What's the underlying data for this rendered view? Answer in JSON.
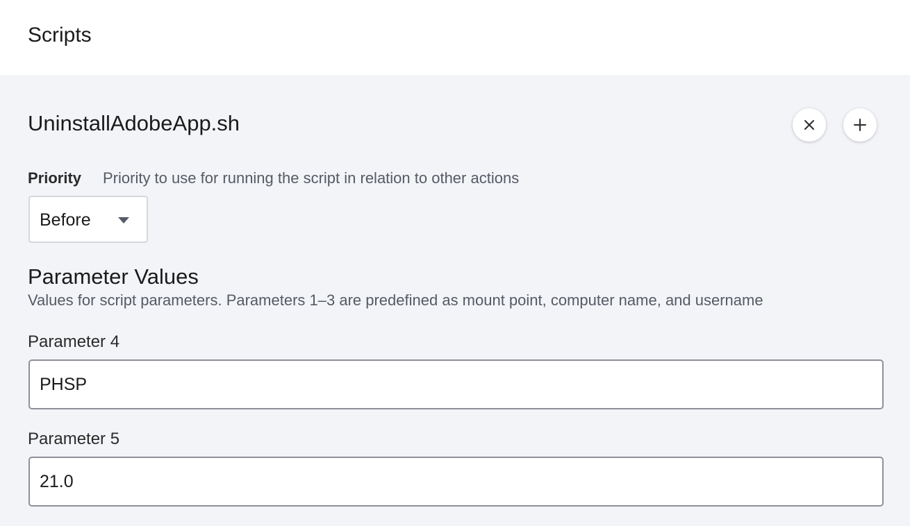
{
  "header": {
    "title": "Scripts"
  },
  "script": {
    "name": "UninstallAdobeApp.sh",
    "remove_icon": "close-icon",
    "add_icon": "plus-icon"
  },
  "priority": {
    "label": "Priority",
    "description": "Priority to use for running the script in relation to other actions",
    "selected": "Before"
  },
  "parameters": {
    "title": "Parameter Values",
    "description": "Values for script parameters. Parameters 1–3 are predefined as mount point, computer name, and username",
    "fields": [
      {
        "label": "Parameter 4",
        "value": "PHSP"
      },
      {
        "label": "Parameter 5",
        "value": "21.0"
      }
    ]
  },
  "colors": {
    "panel_background": "#f3f4f8",
    "input_border": "#8d9099",
    "muted_text": "#555a63"
  }
}
